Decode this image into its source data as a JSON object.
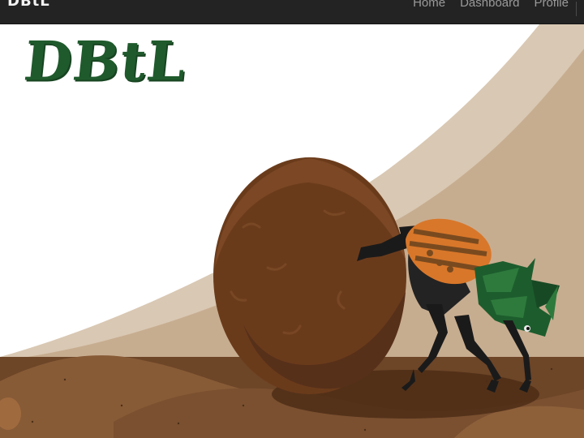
{
  "navbar": {
    "brand": "DBtL",
    "links": [
      {
        "label": "Home"
      },
      {
        "label": "Dashboard"
      },
      {
        "label": "Profile"
      }
    ]
  },
  "hero": {
    "title": "DBtL",
    "illustration": "dung-beetle-rolling-ball"
  },
  "colors": {
    "navbar_bg": "#232323",
    "title_green": "#1f5a2c",
    "hill_back": "#d8c8b4",
    "ground": "#6b4424",
    "dung_ball": "#6a3b1b",
    "beetle_shell": "#d8772a",
    "beetle_head": "#1d5d2d"
  }
}
